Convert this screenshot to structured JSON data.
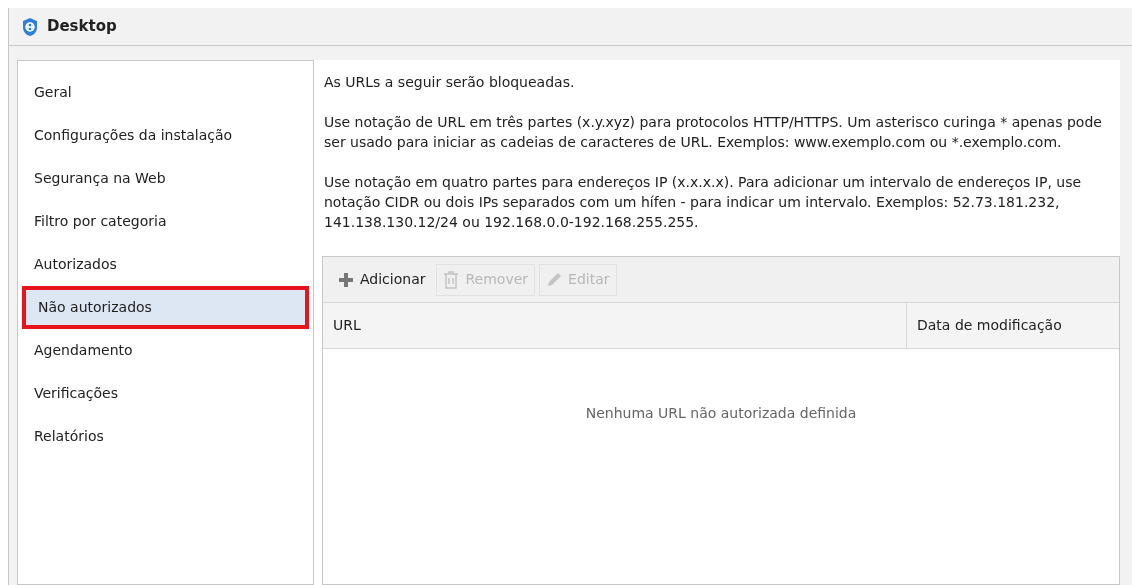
{
  "window": {
    "title": "Desktop"
  },
  "sidebar": {
    "items": [
      {
        "label": "Geral",
        "selected": false,
        "annotated": false
      },
      {
        "label": "Configurações da instalação",
        "selected": false,
        "annotated": false
      },
      {
        "label": "Segurança na Web",
        "selected": false,
        "annotated": false
      },
      {
        "label": "Filtro por categoria",
        "selected": false,
        "annotated": false
      },
      {
        "label": "Autorizados",
        "selected": false,
        "annotated": false
      },
      {
        "label": "Não autorizados",
        "selected": true,
        "annotated": true
      },
      {
        "label": "Agendamento",
        "selected": false,
        "annotated": false
      },
      {
        "label": "Verificações",
        "selected": false,
        "annotated": false
      },
      {
        "label": "Relatórios",
        "selected": false,
        "annotated": false
      }
    ]
  },
  "description": [
    "As URLs a seguir serão bloqueadas.",
    "Use notação de URL em três partes (x.y.xyz) para protocolos HTTP/HTTPS. Um asterisco curinga * apenas pode ser usado para iniciar as cadeias de caracteres de URL. Exemplos: www.exemplo.com ou *.exemplo.com.",
    "Use notação em quatro partes para endereços IP (x.x.x.x). Para adicionar um intervalo de endereços IP, use notação CIDR ou dois IPs separados com um hífen - para indicar um intervalo. Exemplos: 52.73.181.232, 141.138.130.12/24 ou 192.168.0.0-192.168.255.255."
  ],
  "toolbar": [
    {
      "kind": "add",
      "label": "Adicionar",
      "disabled": false
    },
    {
      "kind": "remove",
      "label": "Remover",
      "disabled": true
    },
    {
      "kind": "edit",
      "label": "Editar",
      "disabled": true
    }
  ],
  "table": {
    "columns": [
      "URL",
      "Data de modificação"
    ],
    "empty_message": "Nenhuma URL não autorizada definida"
  }
}
